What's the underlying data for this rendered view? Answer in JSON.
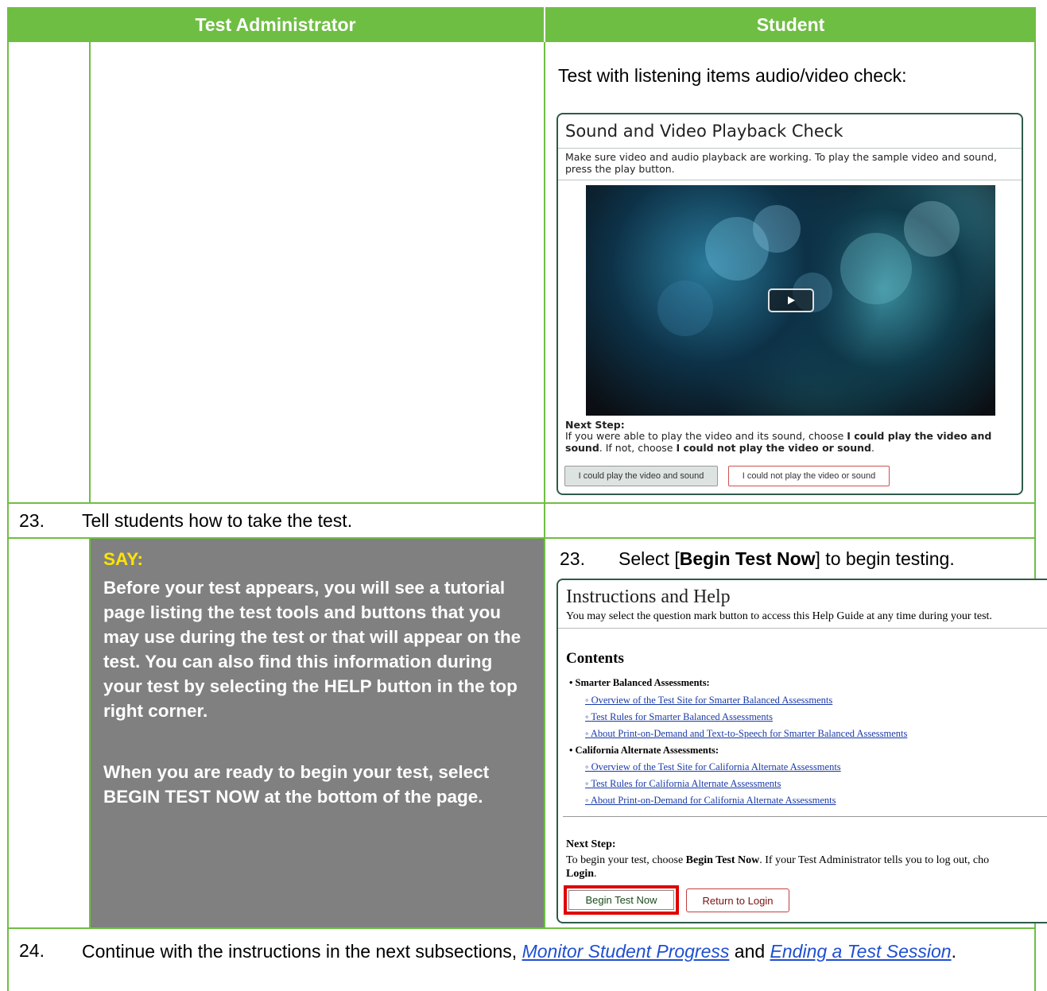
{
  "header": {
    "col_ta": "Test Administrator",
    "col_student": "Student"
  },
  "row1": {
    "student_text": "Test with listening items audio/video check:",
    "shot": {
      "title": "Sound and Video Playback Check",
      "desc": "Make sure video and audio playback are working. To play the sample video and sound, press the play button.",
      "next_step_label": "Next Step:",
      "next_step_1": "If you were able to play the video and its sound, choose ",
      "next_step_bold1": "I could play the video and sound",
      "next_step_2": ". If not, choose ",
      "next_step_bold2": "I could not play the video or sound",
      "next_step_3": ".",
      "btn_ok": "I could play the video and sound",
      "btn_bad": "I could not play the video or sound"
    }
  },
  "row2": {
    "num": "23.",
    "text": "Tell students how to take the test."
  },
  "row3": {
    "say_label": "SAY:",
    "say_p1": "Before your test appears, you will see a tutorial page listing the test tools and buttons that you may use during the test or that will appear on the test. You can also find this information during your test by selecting the HELP button in the top right corner.",
    "say_p2": "When you are ready to begin your test, select BEGIN TEST NOW at the bottom of the page.",
    "student_num": "23.",
    "student_pre": "Select [",
    "student_bold": "Begin Test Now",
    "student_post": "] to begin testing.",
    "shot": {
      "title": "Instructions and Help",
      "subtitle": "You may select the question mark button to access this Help Guide at any time during your test.",
      "contents": "Contents",
      "sec1": "Smarter Balanced Assessments:",
      "sec1_links": [
        "Overview of the Test Site for Smarter Balanced Assessments",
        "Test Rules for Smarter Balanced Assessments",
        "About Print-on-Demand and Text-to-Speech for Smarter Balanced Assessments"
      ],
      "sec2": "California Alternate Assessments:",
      "sec2_links": [
        "Overview of the Test Site for California Alternate Assessments",
        "Test Rules for California Alternate Assessments",
        "About Print-on-Demand for California Alternate Assessments"
      ],
      "next_step_label": "Next Step:",
      "next_1": "To begin your test, choose ",
      "next_bold1": "Begin Test Now",
      "next_2": ". If your Test Administrator tells you to log out, cho",
      "next_bold2": "Login",
      "next_3": ".",
      "btn_begin": "Begin Test Now",
      "btn_return": "Return to Login"
    }
  },
  "row4": {
    "num": "24.",
    "pre": "Continue with the instructions in the next subsections, ",
    "link1": "Monitor Student Progress",
    "mid": " and ",
    "link2": "Ending a Test Session",
    "post": "."
  },
  "colors": {
    "border_green": "#6fbe44",
    "say_gray": "#808080",
    "link_blue": "#1f4fd1",
    "highlight_red": "#e00000"
  }
}
